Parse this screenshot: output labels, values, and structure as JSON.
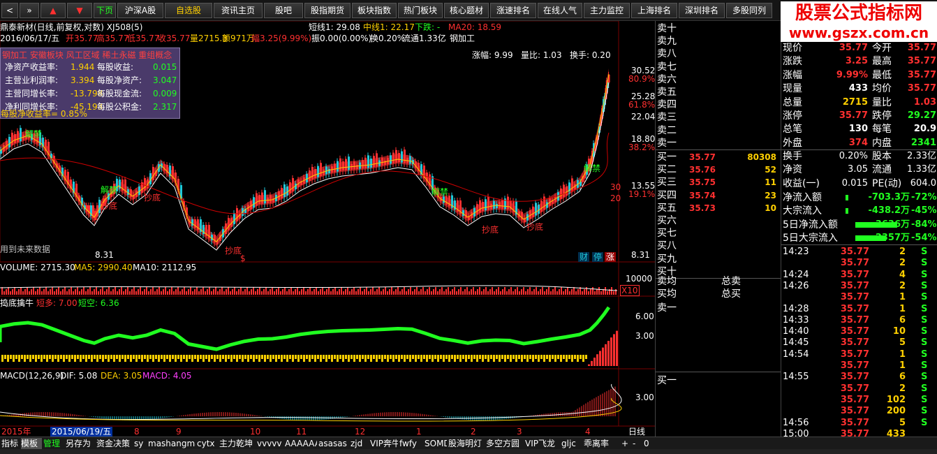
{
  "toolbar": {
    "buttons": [
      "<",
      "»",
      "▲",
      "▼",
      "下页",
      "沪深A股",
      "自选股",
      "资讯主页",
      "股吧",
      "股指期货",
      "板块指数",
      "热门板块",
      "核心题材",
      "涨速排名",
      "在线人气",
      "主力监控",
      "上海排名",
      "深圳排名",
      "多股同列"
    ]
  },
  "logo": {
    "line1": "股票公式指标网",
    "line2": "www.gszx.com.cn"
  },
  "chart_header": {
    "title": "鼎泰新材(日线,前复权,对数) XJ508(5)",
    "short": "短线1: 29.08",
    "mid": "中线1: 22.17",
    "down": "下跌: -",
    "ma20": "MA20: 18.59",
    "date": "2016/06/17/五",
    "open": "开35.77",
    "high": "高35.77",
    "low": "低35.77",
    "close": "收35.77",
    "vol": "量2715.3",
    "amount": "额971万",
    "change": "幅3.25(9.99%)",
    "amp": "振0.00(0.00%)",
    "turn": "换0.20%",
    "float": "流通1.33亿",
    "industry": "钢加工",
    "zhangfu": "涨幅: 9.99",
    "liangbi": "量比: 1.03",
    "huanshou": "换手: 0.20"
  },
  "info_panel": {
    "header": "钢加工 安徽板块 风工区域 稀土永磁 重组概念",
    "rows": [
      [
        "净资产收益率:",
        "1.944",
        "每股收益:",
        "0.015"
      ],
      [
        "主营业利润率:",
        "3.394",
        "每股净资产:",
        "3.047"
      ],
      [
        "主营同增长率:",
        "-13.798",
        "每股现金流:",
        "0.009"
      ],
      [
        "净利同增长率:",
        "-45.193",
        "每股公积金:",
        "2.317"
      ]
    ],
    "footer": "每股净收益率= 0.85%"
  },
  "price_axis": [
    "30.52",
    "80.9%",
    "25.28",
    "61.8%",
    "22.04",
    "18.80",
    "38.2%",
    "13.55",
    "19.1%",
    "8.31",
    "30",
    "20"
  ],
  "chart_labels": {
    "jie": "解禁",
    "chao": "抄底",
    "low": "8.31",
    "future": "用到未来数据",
    "cai": "财",
    "ting": "停",
    "zhang": "涨",
    "dollar": "$"
  },
  "vol_header": {
    "vol": "VOLUME: 2715.30",
    "ma5": "MA5: 2990.40",
    "ma10": "MA10: 2112.95",
    "axis": "10000",
    "x10": "X10"
  },
  "ind2_header": {
    "name": "捣底擒牛",
    "long": "短多: 7.00",
    "short": "短空: 6.36",
    "ax1": "6.00",
    "ax2": "3.00"
  },
  "macd_header": {
    "name": "MACD(12,26,9)",
    "dif": "DIF: 5.08",
    "dea": "DEA: 3.05",
    "macd": "MACD: 4.05",
    "ax": "3.00"
  },
  "date_axis": {
    "year": "2015年",
    "sel": "2015/06/19/五",
    "months": [
      "8",
      "9",
      "10",
      "11",
      "12",
      "1",
      "2",
      "3",
      "4"
    ],
    "period": "日线"
  },
  "orderbook": {
    "sells": [
      "卖十",
      "卖九",
      "卖八",
      "卖七",
      "卖六",
      "卖五",
      "卖四",
      "卖三",
      "卖二",
      "卖一"
    ],
    "buys": [
      [
        "买一",
        "35.77",
        "80308"
      ],
      [
        "买二",
        "35.76",
        "52"
      ],
      [
        "买三",
        "35.75",
        "11"
      ],
      [
        "买四",
        "35.74",
        "23"
      ],
      [
        "买五",
        "35.73",
        "10"
      ],
      [
        "买六",
        "",
        ""
      ],
      [
        "买七",
        "",
        ""
      ],
      [
        "买八",
        "",
        ""
      ],
      [
        "买九",
        "",
        ""
      ],
      [
        "买十",
        "",
        ""
      ]
    ],
    "avg1": "卖均",
    "avg1b": "总卖",
    "avg2": "买均",
    "avg2b": "总买",
    "last": "卖一",
    "last2": "买一"
  },
  "quote": [
    [
      "现价",
      "35.77",
      "今开",
      "35.77"
    ],
    [
      "涨跌",
      "3.25",
      "最高",
      "35.77"
    ],
    [
      "涨幅",
      "9.99%",
      "最低",
      "35.77"
    ],
    [
      "现量",
      "433",
      "均价",
      "35.77"
    ],
    [
      "总量",
      "2715",
      "量比",
      "1.03"
    ],
    [
      "涨停",
      "35.77",
      "跌停",
      "29.27"
    ],
    [
      "总笔",
      "130",
      "每笔",
      "20.9"
    ],
    [
      "外盘",
      "374",
      "内盘",
      "2341"
    ]
  ],
  "quote2": [
    [
      "换手",
      "0.20%",
      "股本",
      "2.33亿"
    ],
    [
      "净资",
      "3.05",
      "流通",
      "1.33亿"
    ],
    [
      "收益(一)",
      "0.015",
      "PE(动)",
      "604.0"
    ]
  ],
  "flows": [
    [
      "净流入额",
      "-703.3万",
      "-72%"
    ],
    [
      "大宗流入",
      "-438.2万",
      "-45%"
    ],
    [
      "5日净流入额",
      "-3636万",
      "-84%"
    ],
    [
      "5日大宗流入",
      "-2357万",
      "-54%"
    ]
  ],
  "ticks": [
    [
      "14:23",
      "35.77",
      "2",
      "S"
    ],
    [
      "",
      "35.77",
      "2",
      "S"
    ],
    [
      "14:24",
      "35.77",
      "4",
      "S"
    ],
    [
      "14:26",
      "35.77",
      "2",
      "S"
    ],
    [
      "",
      "35.77",
      "1",
      "S"
    ],
    [
      "14:28",
      "35.77",
      "1",
      "S"
    ],
    [
      "14:33",
      "35.77",
      "6",
      "S"
    ],
    [
      "14:40",
      "35.77",
      "10",
      "S"
    ],
    [
      "14:45",
      "35.77",
      "5",
      "S"
    ],
    [
      "14:54",
      "35.77",
      "1",
      "S"
    ],
    [
      "",
      "35.77",
      "1",
      "S"
    ],
    [
      "14:55",
      "35.77",
      "6",
      "S"
    ],
    [
      "",
      "35.77",
      "2",
      "S"
    ],
    [
      "",
      "35.77",
      "102",
      "S"
    ],
    [
      "",
      "35.77",
      "200",
      "S"
    ],
    [
      "14:56",
      "35.77",
      "5",
      "S"
    ],
    [
      "15:00",
      "35.77",
      "433",
      ""
    ]
  ],
  "bottom_tabs": [
    "指标",
    "模板",
    "管理",
    "另存为",
    "资金决策",
    "sy",
    "mashangmai",
    "cytx",
    "主力乾坤",
    "vvvvv",
    "AAAAAAA",
    "asasas",
    "zjd",
    "VIP奔牛",
    "fwfy",
    "SOMD",
    "股海明灯",
    "多空方圆",
    "VIP飞龙",
    "gljc",
    "乖离率",
    "+",
    "-",
    "0"
  ],
  "colors": {
    "up": "#ff3030",
    "down": "#20c8d8",
    "green": "#20ff20",
    "yellow": "#ffd000",
    "white": "#ffffff",
    "red_band": "#8b1a1a"
  }
}
